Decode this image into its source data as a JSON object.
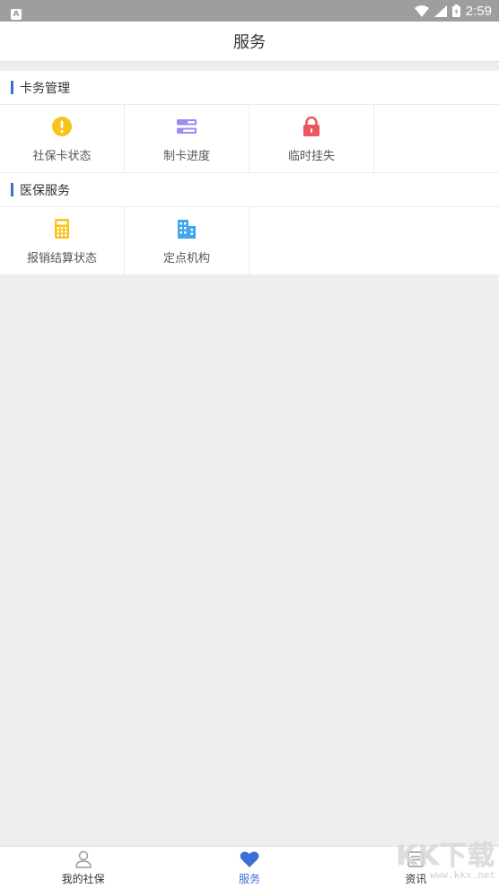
{
  "status_bar": {
    "app_badge": "A",
    "time": "2:59"
  },
  "title": "服务",
  "sections": [
    {
      "label": "卡务管理",
      "items": [
        {
          "label": "社保卡状态",
          "icon": "alert-circle-icon",
          "color": "#f8c31b"
        },
        {
          "label": "制卡进度",
          "icon": "progress-bars-icon",
          "color": "#9b8cf0"
        },
        {
          "label": "临时挂失",
          "icon": "lock-icon",
          "color": "#f0555d"
        }
      ]
    },
    {
      "label": "医保服务",
      "items": [
        {
          "label": "报销结算状态",
          "icon": "calculator-icon",
          "color": "#f8c31b"
        },
        {
          "label": "定点机构",
          "icon": "building-icon",
          "color": "#3fa5ef"
        }
      ]
    }
  ],
  "bottom_nav": [
    {
      "label": "我的社保",
      "icon": "person-icon",
      "active": false
    },
    {
      "label": "服务",
      "icon": "heart-icon",
      "active": true
    },
    {
      "label": "资讯",
      "icon": "news-icon",
      "active": false
    }
  ],
  "watermark": {
    "logo": "KK下载",
    "url": "www.kkx.net"
  },
  "colors": {
    "accent": "#3c6fd6",
    "background": "#eeeeee"
  }
}
